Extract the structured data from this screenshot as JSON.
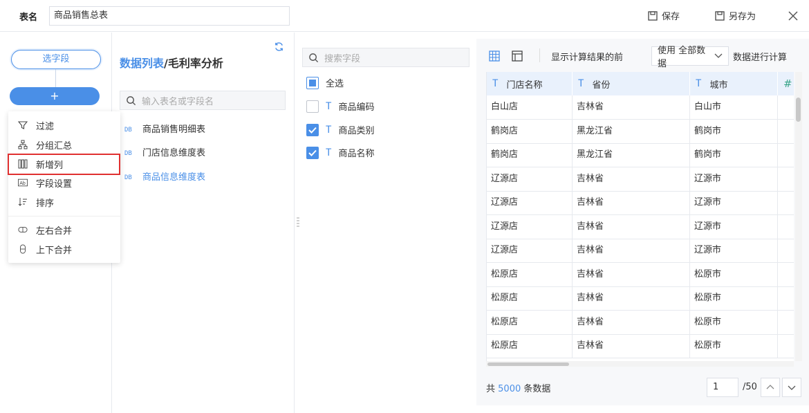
{
  "topbar": {
    "table_name_label": "表名",
    "table_name_value": "商品销售总表",
    "save_label": "保存",
    "save_as_label": "另存为"
  },
  "left": {
    "select_field_label": "选字段",
    "add_label": "+",
    "menu": [
      {
        "label": "过滤",
        "icon": "filter-icon"
      },
      {
        "label": "分组汇总",
        "icon": "group-summary-icon"
      },
      {
        "label": "新增列",
        "icon": "add-column-icon"
      },
      {
        "label": "字段设置",
        "icon": "field-settings-icon"
      },
      {
        "label": "排序",
        "icon": "sort-icon"
      },
      {
        "label": "左右合并",
        "icon": "merge-horizontal-icon"
      },
      {
        "label": "上下合并",
        "icon": "merge-vertical-icon"
      }
    ]
  },
  "datasource": {
    "title_main": "数据列表",
    "title_sub": "/毛利率分析",
    "search_placeholder": "输入表名或字段名",
    "tables": [
      "商品销售明细表",
      "门店信息维度表",
      "商品信息维度表"
    ]
  },
  "fields": {
    "search_placeholder": "搜索字段",
    "select_all": "全选",
    "items": [
      {
        "label": "商品编码",
        "checked": false
      },
      {
        "label": "商品类别",
        "checked": true
      },
      {
        "label": "商品名称",
        "checked": true
      }
    ]
  },
  "preview": {
    "toolbar_text_before": "显示计算结果的前",
    "toolbar_select_value": "使用 全部数据",
    "toolbar_text_after": "数据进行计算",
    "columns": [
      "门店名称",
      "省份",
      "城市"
    ],
    "rows": [
      [
        "白山店",
        "吉林省",
        "白山市"
      ],
      [
        "鹤岗店",
        "黑龙江省",
        "鹤岗市"
      ],
      [
        "鹤岗店",
        "黑龙江省",
        "鹤岗市"
      ],
      [
        "辽源店",
        "吉林省",
        "辽源市"
      ],
      [
        "辽源店",
        "吉林省",
        "辽源市"
      ],
      [
        "辽源店",
        "吉林省",
        "辽源市"
      ],
      [
        "辽源店",
        "吉林省",
        "辽源市"
      ],
      [
        "松原店",
        "吉林省",
        "松原市"
      ],
      [
        "松原店",
        "吉林省",
        "松原市"
      ],
      [
        "松原店",
        "吉林省",
        "松原市"
      ],
      [
        "松原店",
        "吉林省",
        "松原市"
      ]
    ],
    "total_prefix": "共",
    "total_count": "5000",
    "total_suffix": "条数据",
    "current_page": "1",
    "total_pages": "/50"
  },
  "colors": {
    "accent": "#4a8fe7",
    "highlight": "#e03030"
  }
}
